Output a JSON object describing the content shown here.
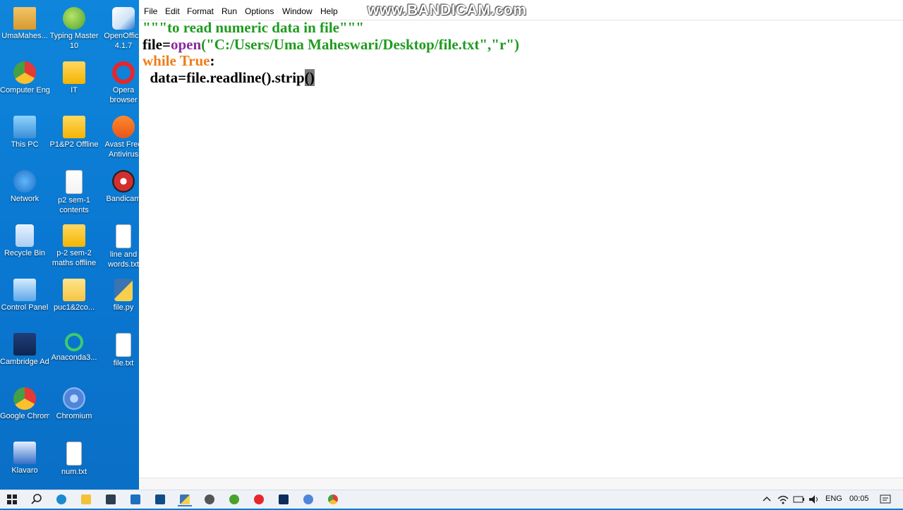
{
  "desktop": {
    "icons": [
      {
        "label": "UmaMahes...",
        "icon": "user-folder-icon"
      },
      {
        "label": "Typing Master 10",
        "icon": "typing-master-icon"
      },
      {
        "label": "OpenOffice 4.1.7",
        "icon": "openoffice-icon"
      },
      {
        "label": "Computer Engineerin...",
        "icon": "chrome-shortcut-icon"
      },
      {
        "label": "IT",
        "icon": "zip-folder-icon"
      },
      {
        "label": "Opera browser",
        "icon": "opera-icon"
      },
      {
        "label": "This PC",
        "icon": "this-pc-icon"
      },
      {
        "label": "P1&P2 Offline",
        "icon": "zip-folder-icon"
      },
      {
        "label": "Avast Free Antivirus",
        "icon": "avast-icon"
      },
      {
        "label": "Network",
        "icon": "network-icon"
      },
      {
        "label": "p2 sem-1 contents",
        "icon": "pdf-icon"
      },
      {
        "label": "Bandicam",
        "icon": "bandicam-icon"
      },
      {
        "label": "Recycle Bin",
        "icon": "recycle-bin-icon"
      },
      {
        "label": "p-2 sem-2 maths offline",
        "icon": "zip-folder-icon"
      },
      {
        "label": "line and words.txt",
        "icon": "text-file-icon"
      },
      {
        "label": "Control Panel",
        "icon": "control-panel-icon"
      },
      {
        "label": "puc1&2co...",
        "icon": "folder-icon"
      },
      {
        "label": "file.py",
        "icon": "python-file-icon"
      },
      {
        "label": "Cambridge Advanced...",
        "icon": "cambridge-icon"
      },
      {
        "label": "Anaconda3...",
        "icon": "anaconda-icon"
      },
      {
        "label": "file.txt",
        "icon": "text-file-icon"
      },
      {
        "label": "Google Chrome",
        "icon": "chrome-icon"
      },
      {
        "label": "Chromium",
        "icon": "chromium-icon"
      },
      {
        "label": "Klavaro",
        "icon": "klavaro-icon"
      },
      {
        "label": "num.txt",
        "icon": "text-file-icon"
      }
    ]
  },
  "editor": {
    "menu": [
      "File",
      "Edit",
      "Format",
      "Run",
      "Options",
      "Window",
      "Help"
    ],
    "watermark": "www.BANDICAM.com",
    "code": {
      "line1": "\"\"\"to read numeric data in file\"\"\"",
      "line2_var": "file=",
      "line2_func": "open",
      "line2_args": "(\"C:/Users/Uma Maheswari/Desktop/file.txt\",\"r\")",
      "line3_kw": "while True",
      "line3_colon": ":",
      "line4_indent": "  ",
      "line4_code": "data=file.readline().strip",
      "line4_sel": "()"
    }
  },
  "taskbar": {
    "language": "ENG",
    "time": "00:05"
  },
  "colors": {
    "string": "#1f9b1f",
    "keyword": "#ef7d1a",
    "builtin": "#8a2b9e",
    "desktop_bg": "#0a7ad0"
  }
}
